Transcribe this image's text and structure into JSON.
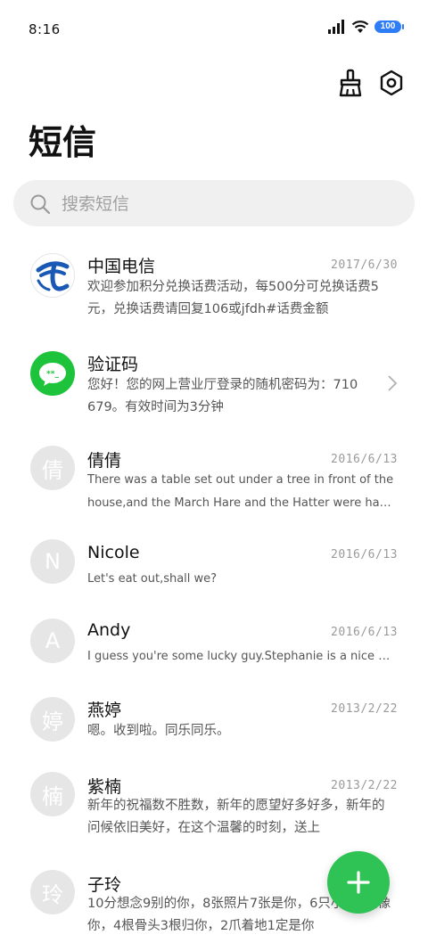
{
  "status_bar": {
    "time": "8:16",
    "battery": "100"
  },
  "header": {
    "title": "短信"
  },
  "search": {
    "placeholder": "搜索短信"
  },
  "colors": {
    "accent_green": "#2fc254",
    "battery_blue": "#2f7df6",
    "telecom_blue": "#1a58b5",
    "wechat_green": "#1dc33b"
  },
  "messages": [
    {
      "name": "中国电信",
      "date": "2017/6/30",
      "avatar": "china-telecom-logo-icon",
      "preview": "欢迎参加积分兑换话费活动，每500分可兑换话费5元，兑换话费请回复106或jfdh#话费金额"
    },
    {
      "name": "验证码",
      "date": "",
      "avatar": "message-bubble-icon",
      "preview": "您好！您的网上营业厅登录的随机密码为：710679。有效时间为3分钟"
    },
    {
      "name": "倩倩",
      "date": "2016/6/13",
      "avatar_char": "倩",
      "preview": "There was a table set out under a tree in front of the house,and the March Hare and the Hatter were having tea"
    },
    {
      "name": "Nicole",
      "date": "2016/6/13",
      "avatar_char": "N",
      "preview": "Let's eat out,shall we?"
    },
    {
      "name": "Andy",
      "date": "2016/6/13",
      "avatar_char": "A",
      "preview": "I guess you're some lucky guy.Stephanie is a nice girl."
    },
    {
      "name": "燕婷",
      "date": "2013/2/22",
      "avatar_char": "婷",
      "preview": "嗯。收到啦。同乐同乐。"
    },
    {
      "name": "紫楠",
      "date": "2013/2/22",
      "avatar_char": "楠",
      "preview": "新年的祝福数不胜数，新年的愿望好多好多，新年的问候依旧美好，在这个温馨的时刻，送上"
    },
    {
      "name": "子玲",
      "date": "",
      "avatar_char": "玲",
      "preview": "10分想念9别的你，8张照片7张是你，6只小狗5只像你，4根骨头3根归你，2爪着地1定是你"
    }
  ]
}
